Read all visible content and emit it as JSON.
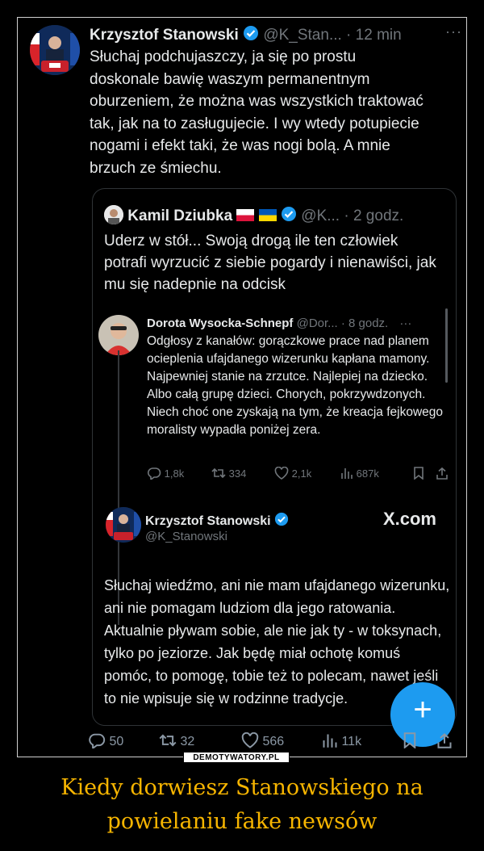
{
  "main_post": {
    "name": "Krzysztof Stanowski",
    "handle_time": "@K_Stan... · 12 min",
    "more": "···",
    "text": "Słuchaj podchujaszczy, ja się po prostu doskonale bawię waszym permanentnym oburzeniem, że można was wszystkich traktować tak, jak na to zasługujecie. I wy wtedy potupiecie nogami i efekt taki, że was nogi bolą. A mnie brzuch ze śmiechu."
  },
  "quoted_post": {
    "name": "Kamil Dziubka",
    "handle_time": "@K... · 2 godz.",
    "text": "Uderz w stół... Swoją drogą ile ten człowiek potrafi wyrzucić z siebie pogardy i nienawiści, jak mu się nadepnie na odcisk"
  },
  "inner_post": {
    "name": "Dorota Wysocka-Schnepf",
    "handle_time": "@Dor... · 8 godz.",
    "more": "···",
    "text": "Odgłosy z kanałów: gorączkowe prace nad planem ocieplenia ufajdanego wizerunku kapłana mamony. Najpewniej stanie na zrzutce. Najlepiej na dziecko. Albo całą grupę dzieci. Chorych, pokrzywdzonych. Niech choć one zyskają na tym, że kreacja fejkowego moralisty wypadła poniżej zera.",
    "replies": "1,8k",
    "reposts": "334",
    "likes": "2,1k",
    "views": "687k"
  },
  "reply_post": {
    "name": "Krzysztof Stanowski",
    "handle": "@K_Stanowski",
    "brand": "X.com",
    "text": "Słuchaj wiedźmo, ani nie mam ufajdanego wizerunku, ani nie pomagam ludziom dla jego ratowania. Aktualnie pływam sobie, ale nie jak ty - w toksynach, tylko po jeziorze. Jak będę miał ochotę komuś pomóc, to pomogę, tobie też to polecam, nawet jeśli to nie wpisuje się w rodzinne tradycje."
  },
  "main_actions": {
    "replies": "50",
    "reposts": "32",
    "likes": "566",
    "views": "11k"
  },
  "fab": {
    "label": "+"
  },
  "watermark": "DEMOTYWATORY.PL",
  "caption": {
    "line1": "Kiedy dorwiesz Stanowskiego na",
    "line2": "powielaniu fake newsów"
  },
  "colors": {
    "accent": "#1d9bf0",
    "caption": "#f7b500",
    "background": "#000000",
    "muted": "#71767b"
  },
  "icons": [
    "verified-badge-icon",
    "poland-flag-icon",
    "ukraine-flag-icon",
    "reply-icon",
    "repost-icon",
    "like-icon",
    "views-icon",
    "bookmark-icon",
    "share-icon",
    "plus-icon"
  ]
}
